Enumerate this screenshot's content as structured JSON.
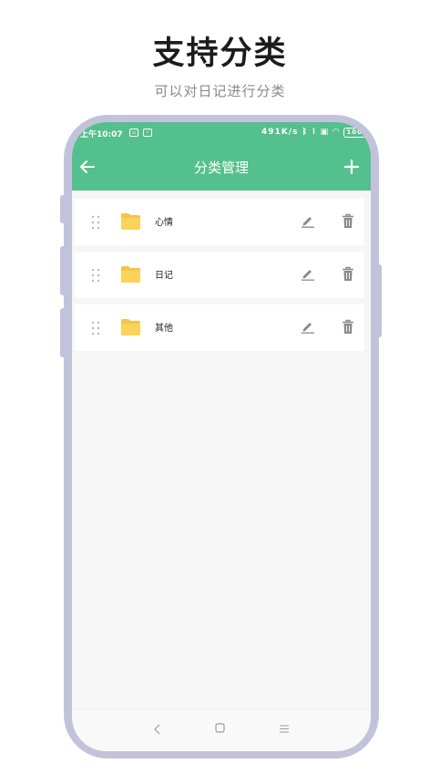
{
  "promo": {
    "title": "支持分类",
    "subtitle": "可以对日记进行分类"
  },
  "status_bar": {
    "time": "上午10:07",
    "network_speed": "491K/s",
    "battery": "100"
  },
  "app_bar": {
    "title": "分类管理",
    "back_icon": "arrow-left-icon",
    "add_icon": "plus-icon"
  },
  "categories": [
    {
      "label": "心情"
    },
    {
      "label": "日记"
    },
    {
      "label": "其他"
    }
  ],
  "colors": {
    "accent": "#54c08d",
    "folder": "#f7c247",
    "frame": "#c2c3db"
  }
}
